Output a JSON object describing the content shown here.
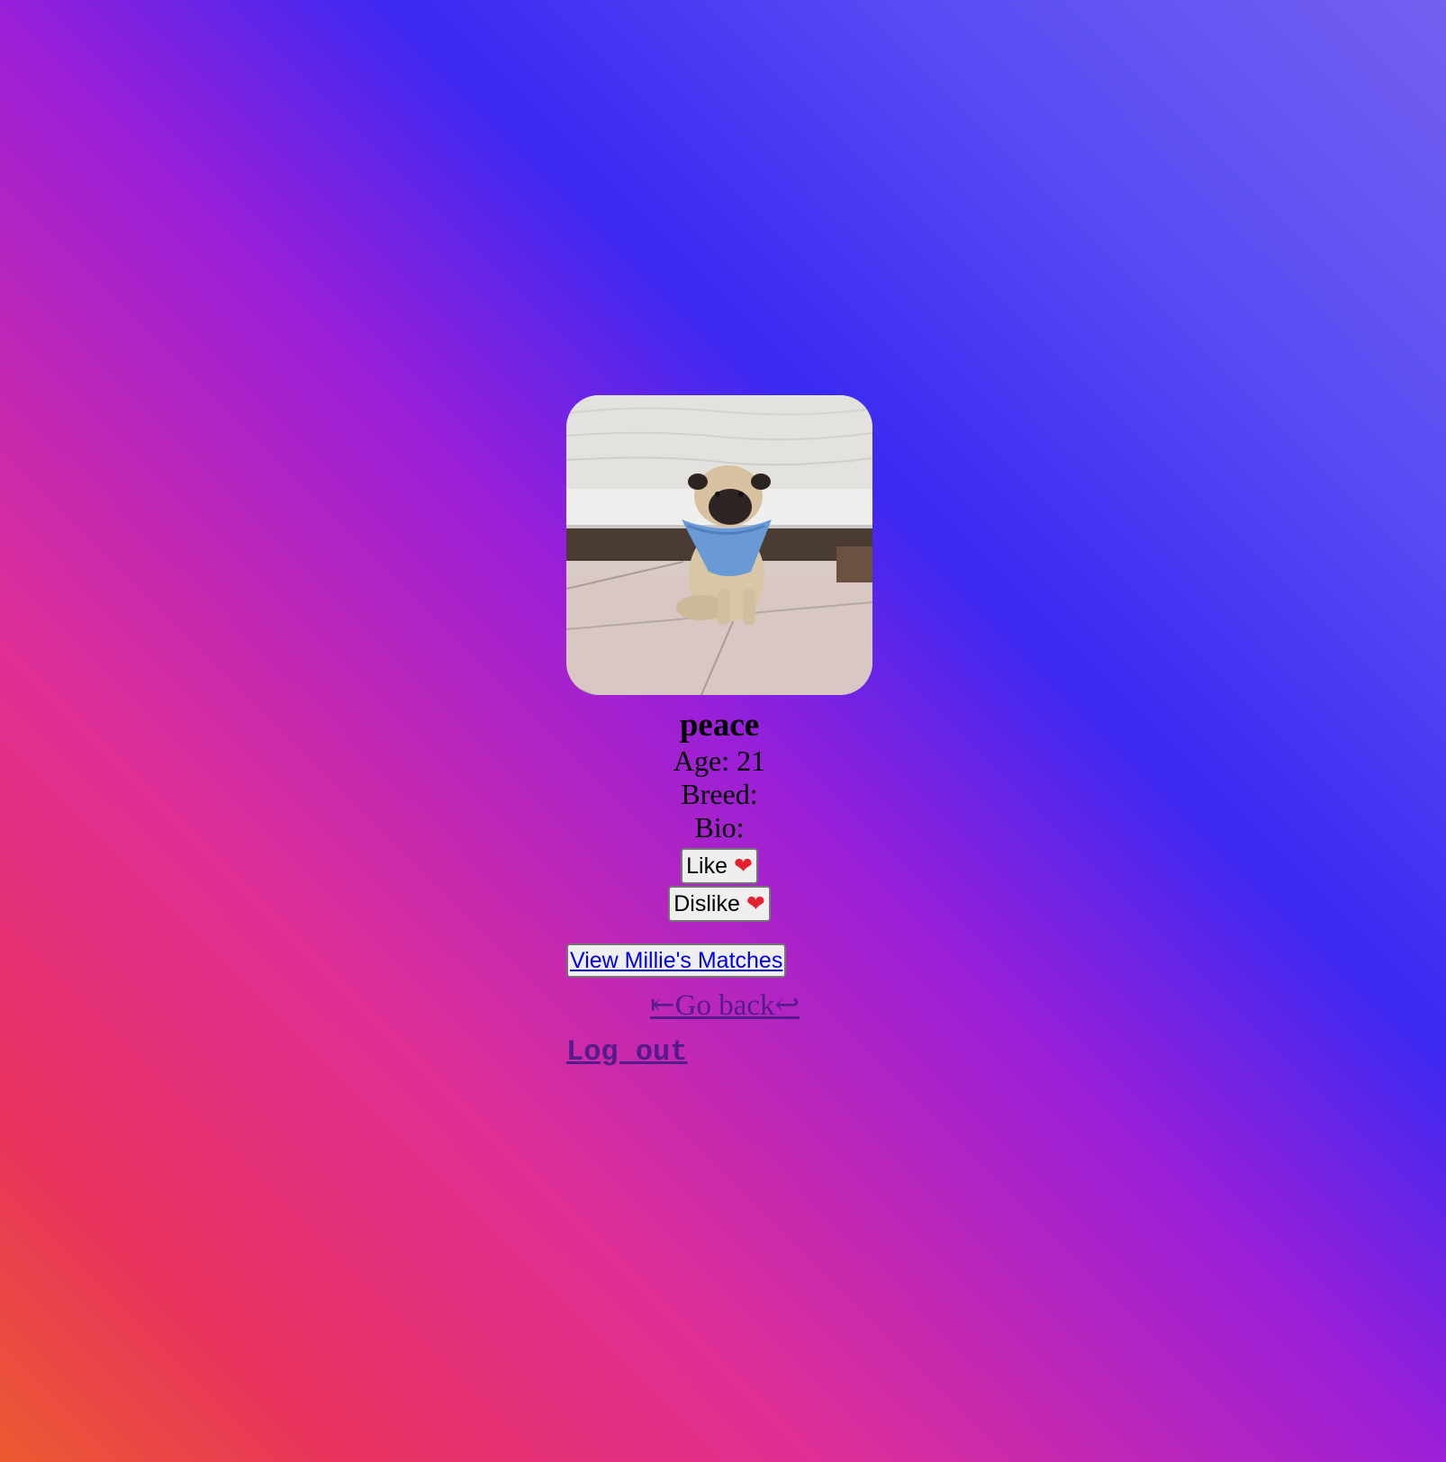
{
  "profile": {
    "photo_alt": "",
    "name": "peace",
    "age_text": "Age: 21",
    "breed_text": "Breed:",
    "bio_text": "Bio:"
  },
  "actions": {
    "like_label": "Like",
    "like_icon": "red-heart-icon",
    "dislike_label": "Dislike",
    "dislike_icon": "broken-heart-icon"
  },
  "links": {
    "matches_label": "View Millie's Matches",
    "go_back_label": "⇤Go back↩",
    "logout_label": "Log out"
  },
  "colors": {
    "link": "#0000ee",
    "visited_link": "#551a8b",
    "heart": "#e4202e"
  }
}
